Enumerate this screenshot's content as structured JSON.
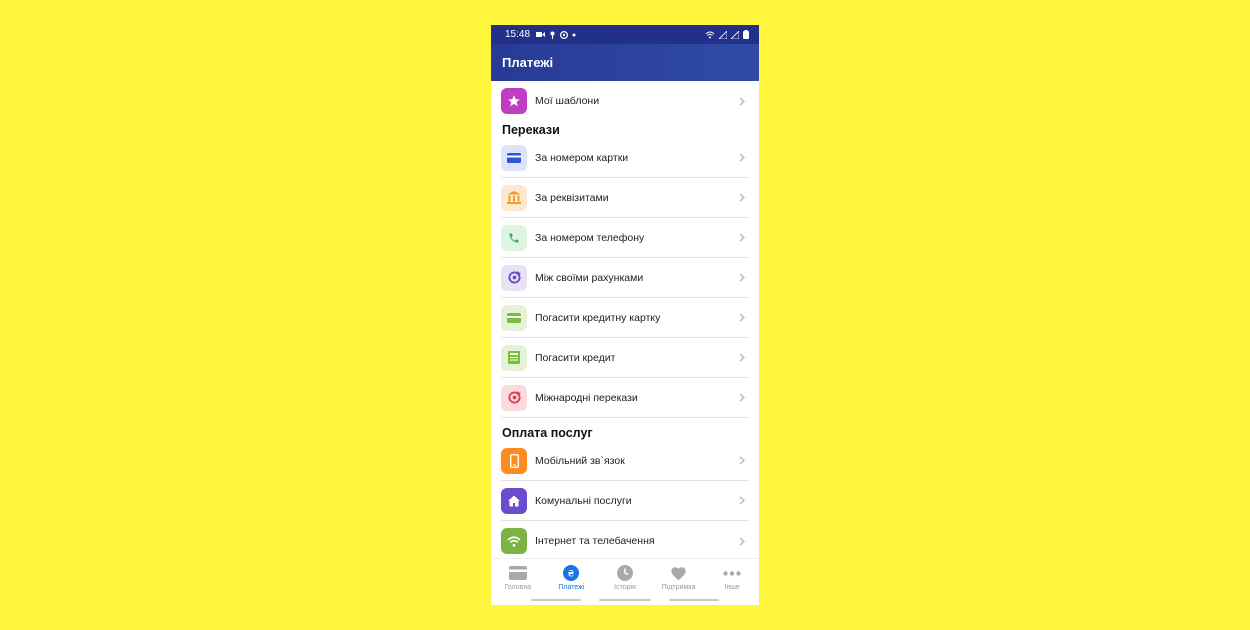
{
  "status_bar": {
    "time": "15:48",
    "icons": [
      "video-icon",
      "fan-icon",
      "circle-icon",
      "dot-icon",
      "wifi-icon",
      "signal-icon",
      "signal-icon-2",
      "battery-icon"
    ]
  },
  "header": {
    "title": "Платежі"
  },
  "favorites": {
    "label": "Мої шаблони",
    "icon": "star-icon",
    "color": "#c03cc2"
  },
  "transfers": {
    "title": "Перекази",
    "items": [
      {
        "label": "За номером картки",
        "icon": "card-icon",
        "bg": "#dce3fb",
        "fg": "#2e55d6"
      },
      {
        "label": "За реквізитами",
        "icon": "bank-icon",
        "bg": "#fde9cf",
        "fg": "#f09a2c"
      },
      {
        "label": "За номером телефону",
        "icon": "phone-icon",
        "bg": "#dff5e4",
        "fg": "#31b553"
      },
      {
        "label": "Між своїми рахунками",
        "icon": "exchange-icon",
        "bg": "#e7e3f7",
        "fg": "#6e49c9"
      },
      {
        "label": "Погасити кредитну картку",
        "icon": "credit-card-icon",
        "bg": "#e6f2d8",
        "fg": "#7cbd3e"
      },
      {
        "label": "Погасити кредит",
        "icon": "calculator-icon",
        "bg": "#e6f2d8",
        "fg": "#7cbd3e"
      },
      {
        "label": "Міжнародні перекази",
        "icon": "international-icon",
        "bg": "#fadcdf",
        "fg": "#e23d4e"
      }
    ]
  },
  "services": {
    "title": "Оплата послуг",
    "items": [
      {
        "label": "Мобільний зв`язок",
        "icon": "mobile-icon",
        "bg": "#fb8c1d",
        "fg": "#ffffff"
      },
      {
        "label": "Комунальні послуги",
        "icon": "home-icon",
        "bg": "#6a4ccc",
        "fg": "#ffffff"
      },
      {
        "label": "Інтернет та телебачення",
        "icon": "wifi-icon",
        "bg": "#7cb342",
        "fg": "#ffffff"
      }
    ]
  },
  "tabs": [
    {
      "label": "Головна",
      "icon": "wallet-icon",
      "active": false
    },
    {
      "label": "Платежі",
      "icon": "payments-icon",
      "active": true
    },
    {
      "label": "Історія",
      "icon": "clock-icon",
      "active": false
    },
    {
      "label": "Підтримка",
      "icon": "heart-icon",
      "active": false
    },
    {
      "label": "Інше",
      "icon": "more-icon",
      "active": false
    }
  ]
}
